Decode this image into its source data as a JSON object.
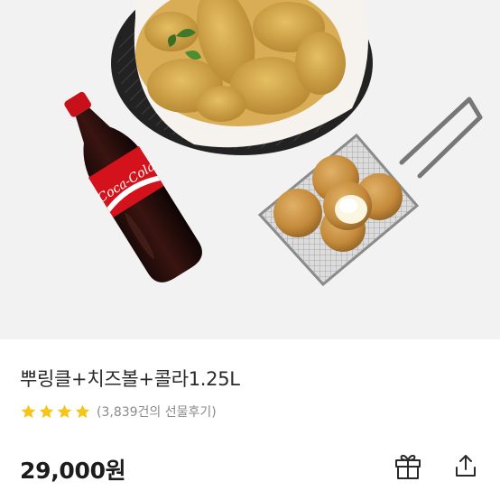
{
  "product": {
    "name": "뿌링클+치즈볼+콜라1.25L",
    "review_summary": "(3,839건의 선물후기)",
    "rating_stars": 4,
    "price": "29,000원"
  },
  "hero": {
    "cola_label": "Coca-Cola"
  },
  "icons": {
    "star": "star-icon",
    "gift": "gift-icon",
    "share": "share-icon"
  },
  "colors": {
    "star": "#f5c51a",
    "hero_background": "#f2f2f2",
    "cola_red": "#d4121b"
  }
}
